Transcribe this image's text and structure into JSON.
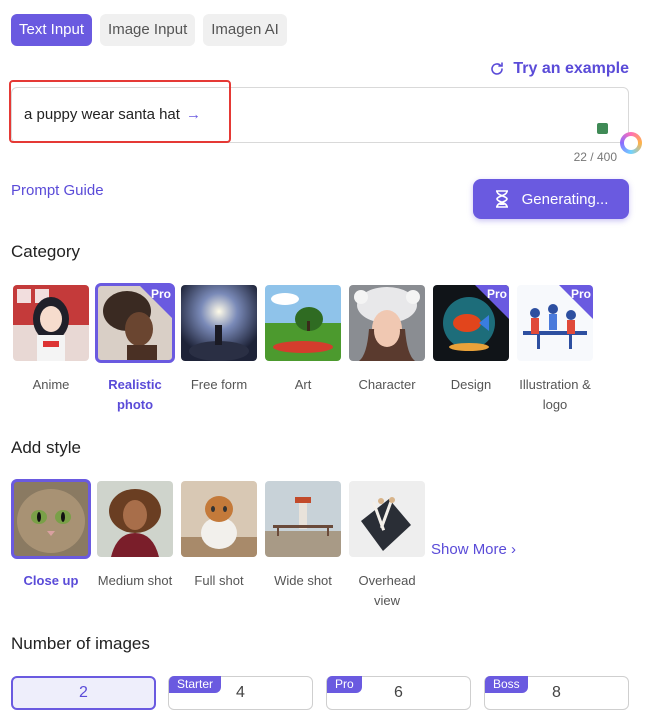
{
  "tabs": [
    {
      "label": "Text Input",
      "active": true
    },
    {
      "label": "Image Input",
      "active": false
    },
    {
      "label": "Imagen AI",
      "active": false
    }
  ],
  "try_example": "Try an example",
  "prompt": {
    "value": "a puppy wear santa hat",
    "counter": "22 / 400"
  },
  "prompt_guide": "Prompt Guide",
  "generate_button": "Generating...",
  "category": {
    "title": "Category",
    "items": [
      {
        "label": "Anime",
        "pro": false,
        "selected": false
      },
      {
        "label": "Realistic photo",
        "pro": true,
        "selected": true
      },
      {
        "label": "Free form",
        "pro": false,
        "selected": false
      },
      {
        "label": "Art",
        "pro": false,
        "selected": false
      },
      {
        "label": "Character",
        "pro": false,
        "selected": false
      },
      {
        "label": "Design",
        "pro": true,
        "selected": false
      },
      {
        "label": "Illustration & logo",
        "pro": true,
        "selected": false
      }
    ],
    "pro_badge": "Pro"
  },
  "style": {
    "title": "Add style",
    "items": [
      {
        "label": "Close up",
        "selected": true
      },
      {
        "label": "Medium shot",
        "selected": false
      },
      {
        "label": "Full shot",
        "selected": false
      },
      {
        "label": "Wide shot",
        "selected": false
      },
      {
        "label": "Overhead view",
        "selected": false
      }
    ],
    "show_more": "Show More"
  },
  "images": {
    "title": "Number of images",
    "options": [
      {
        "value": "2",
        "tag": "",
        "active": true
      },
      {
        "value": "4",
        "tag": "Starter",
        "active": false
      },
      {
        "value": "6",
        "tag": "Pro",
        "active": false
      },
      {
        "value": "8",
        "tag": "Boss",
        "active": false
      }
    ]
  },
  "colors": {
    "accent": "#6a5ae0",
    "highlight": "#e53935"
  }
}
